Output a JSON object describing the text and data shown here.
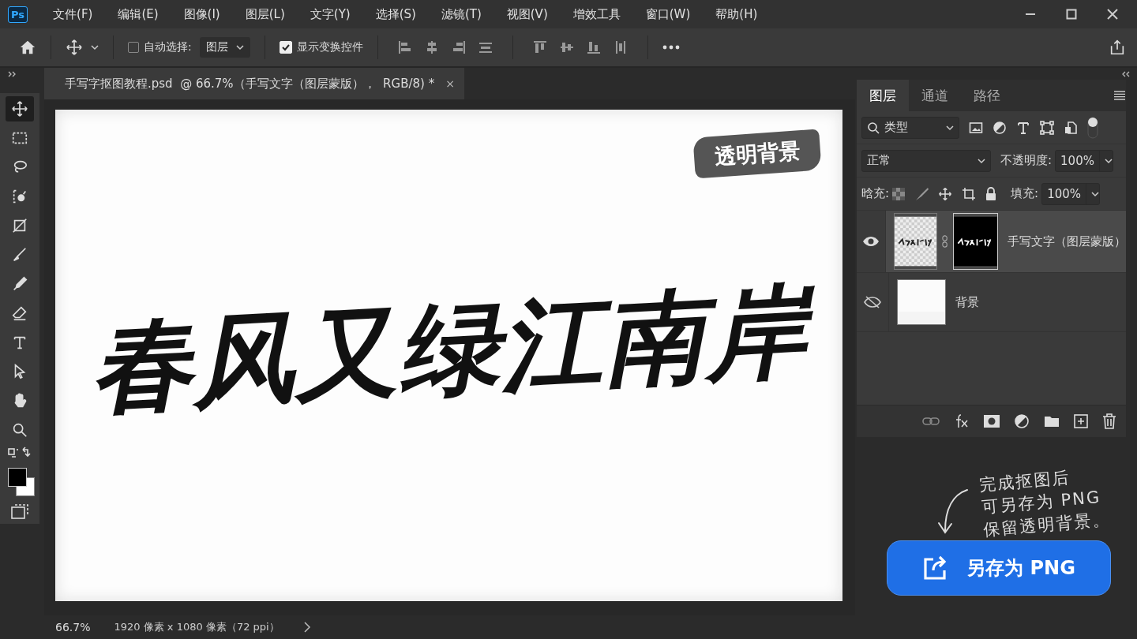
{
  "menu_bar": {
    "app_badge": "Ps",
    "items": [
      "文件(F)",
      "编辑(E)",
      "图像(I)",
      "图层(L)",
      "文字(Y)",
      "选择(S)",
      "滤镜(T)",
      "视图(V)",
      "增效工具",
      "窗口(W)",
      "帮助(H)"
    ]
  },
  "options_bar": {
    "auto_select": {
      "label": "自动选择:",
      "checked": false
    },
    "target": {
      "value": "图层"
    },
    "transform_controls": {
      "label": "显示变换控件",
      "checked": true
    }
  },
  "document_tab": {
    "title": "手写字抠图教程.psd  @ 66.7%（手写文字（图层蒙版），  RGB/8) *",
    "close": "×"
  },
  "tools": [
    {
      "selected": true
    },
    {
      "selected": false
    },
    {
      "selected": false
    },
    {
      "selected": false
    },
    {
      "selected": false
    },
    {
      "selected": false
    },
    {
      "selected": false
    },
    {
      "selected": false
    },
    {
      "selected": false
    },
    {
      "selected": false
    },
    {
      "selected": false
    },
    {
      "selected": false
    }
  ],
  "canvas": {
    "badge": "透明背景",
    "calligraphy": "春风又绿江南岸"
  },
  "layers_panel": {
    "tabs": [
      {
        "label": "图层",
        "selected": true
      },
      {
        "label": "通道",
        "selected": false
      },
      {
        "label": "路径",
        "selected": false
      }
    ],
    "filter": {
      "value": "类型"
    },
    "blend_mode": {
      "value": "正常"
    },
    "opacity": {
      "label": "不透明度:",
      "value": "100%"
    },
    "lock": {
      "label": "晗充:"
    },
    "fill": {
      "label": "填充:",
      "value": "100%"
    },
    "layers": [
      {
        "name": "手写文字（图层蒙版）",
        "visible": true,
        "selected": true,
        "kind": "masked"
      },
      {
        "name": "背景",
        "visible": false,
        "selected": false,
        "kind": "plain"
      }
    ]
  },
  "annotation": {
    "lines": [
      "完成抠图后",
      "可另存为 PNG",
      "保留透明背景。"
    ]
  },
  "save_button": {
    "label": "另存为 PNG"
  },
  "status_bar": {
    "zoom": "66.7%",
    "document_info": "1920 像素 x 1080 像素（72 ppi）"
  }
}
